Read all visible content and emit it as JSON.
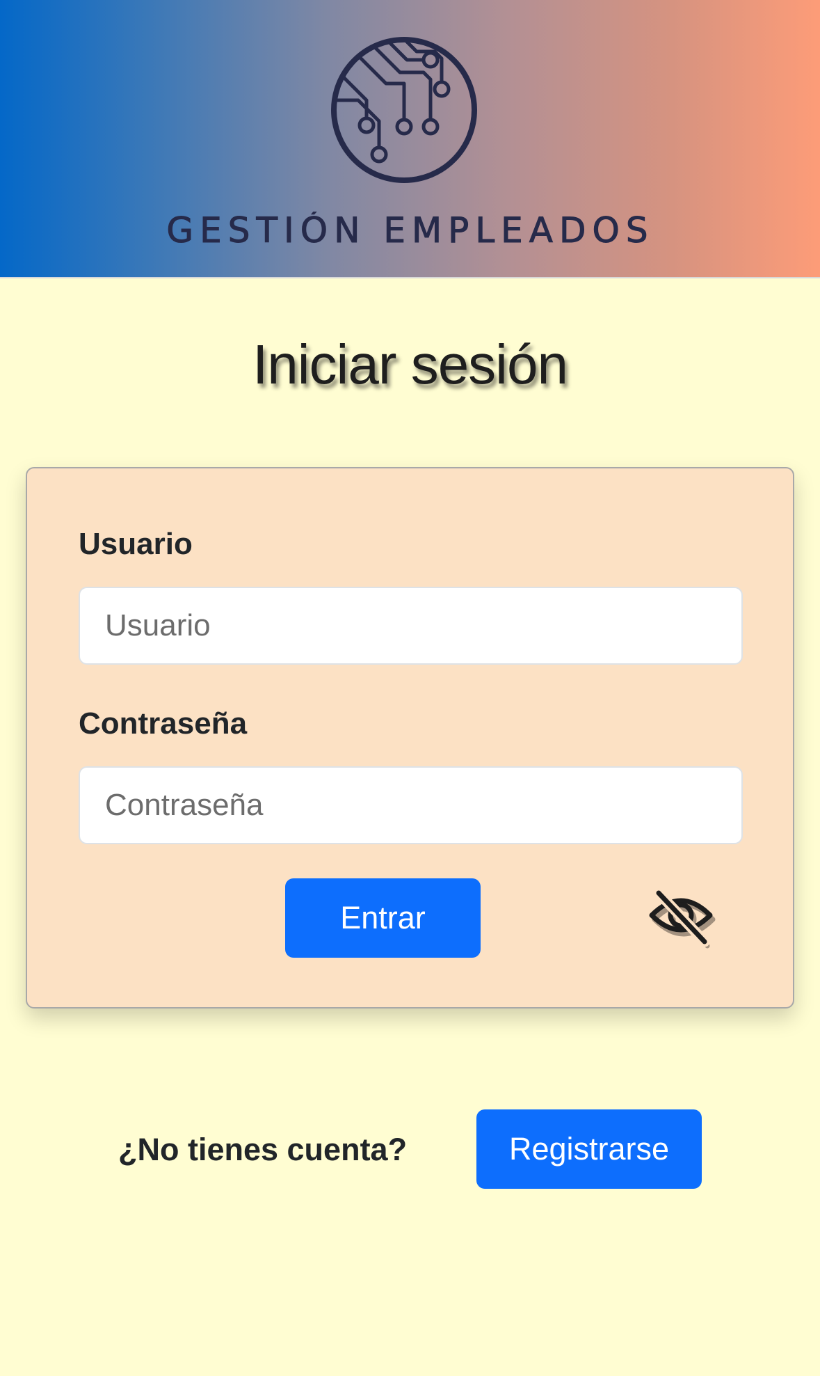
{
  "header": {
    "logo_icon": "circuit-board-icon",
    "brand_name": "GESTIÓN EMPLEADOS",
    "gradient_start": "#0468c8",
    "gradient_end": "#fd9c78"
  },
  "page": {
    "title": "Iniciar sesión",
    "background": "#fffdd2"
  },
  "login_form": {
    "card_color": "#fce1c4",
    "username": {
      "label": "Usuario",
      "placeholder": "Usuario",
      "value": ""
    },
    "password": {
      "label": "Contraseña",
      "placeholder": "Contraseña",
      "value": ""
    },
    "submit_label": "Entrar",
    "visibility_toggle_icon": "eye-slash-icon"
  },
  "signup": {
    "prompt": "¿No tienes cuenta?",
    "button_label": "Registrarse"
  },
  "colors": {
    "primary": "#0d6efd",
    "text": "#212529"
  }
}
